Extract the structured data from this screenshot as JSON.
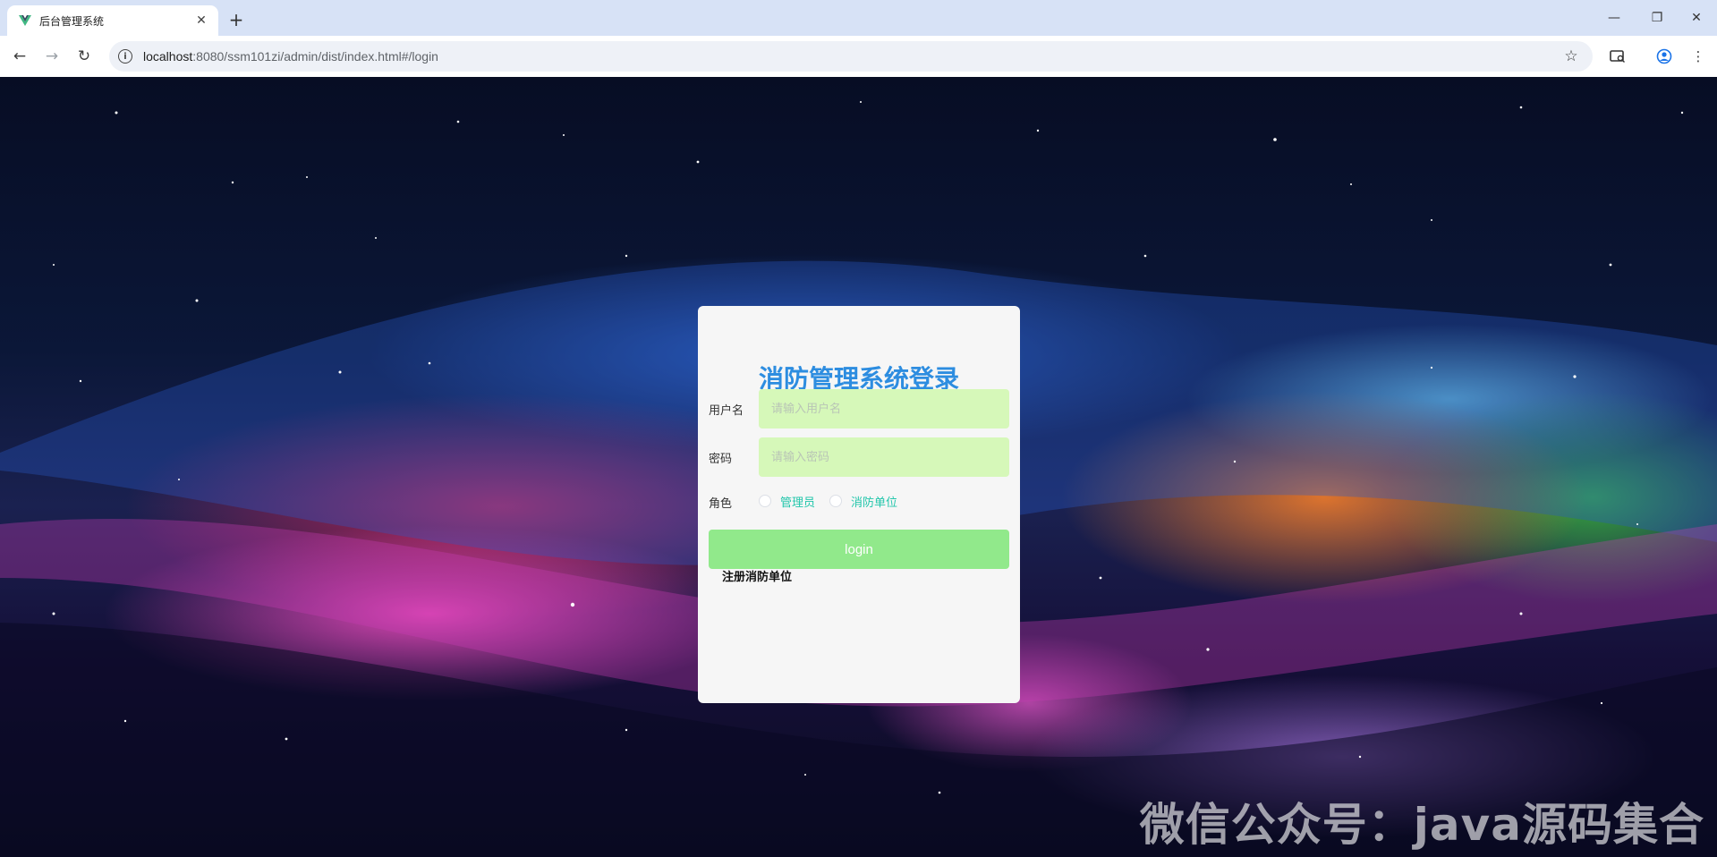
{
  "browser": {
    "tab_title": "后台管理系统",
    "url_host": "localhost",
    "url_path": ":8080/ssm101zi/admin/dist/index.html#/login",
    "favicon_icon": "vue-logo-icon"
  },
  "login": {
    "title": "消防管理系统登录",
    "username_label": "用户名",
    "username_placeholder": "请输入用户名",
    "password_label": "密码",
    "password_placeholder": "请输入密码",
    "role_label": "角色",
    "roles": [
      "管理员",
      "消防单位"
    ],
    "login_button": "login",
    "register_link": "注册消防单位"
  },
  "watermark": "微信公众号：java源码集合",
  "colors": {
    "title": "#2d8de0",
    "input_bg": "#d6f8b9",
    "button_bg": "#91e98b",
    "radio_label": "#22c6ab",
    "card_bg": "#f6f6f6"
  }
}
